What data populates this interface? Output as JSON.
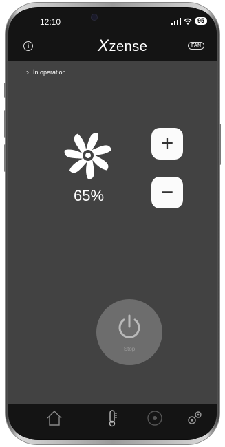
{
  "status_bar": {
    "time": "12:10",
    "battery": "95",
    "signal_icon": "signal-bars-icon",
    "wifi_icon": "wifi-icon"
  },
  "header": {
    "logo_x": "X",
    "logo_rest": "zense",
    "info_icon": "info-icon",
    "badge": "FAN"
  },
  "status": {
    "label": "In operation",
    "chevron": "›"
  },
  "fan": {
    "speed": "65%",
    "speed_fraction": 0.65,
    "icon": "fan-icon"
  },
  "controls": {
    "plus": "+",
    "minus": "−"
  },
  "power": {
    "label": "Stop",
    "icon": "power-icon"
  },
  "nav": [
    {
      "name": "home",
      "icon": "home-icon"
    },
    {
      "name": "thermometer",
      "icon": "thermometer-icon"
    },
    {
      "name": "fan",
      "icon": "fan-icon"
    },
    {
      "name": "settings",
      "icon": "gears-icon"
    }
  ],
  "colors": {
    "screen_bg": "#424242",
    "bar_bg": "#141414",
    "button_bg": "#fbfbfb",
    "power_bg": "#6d6d6d"
  }
}
